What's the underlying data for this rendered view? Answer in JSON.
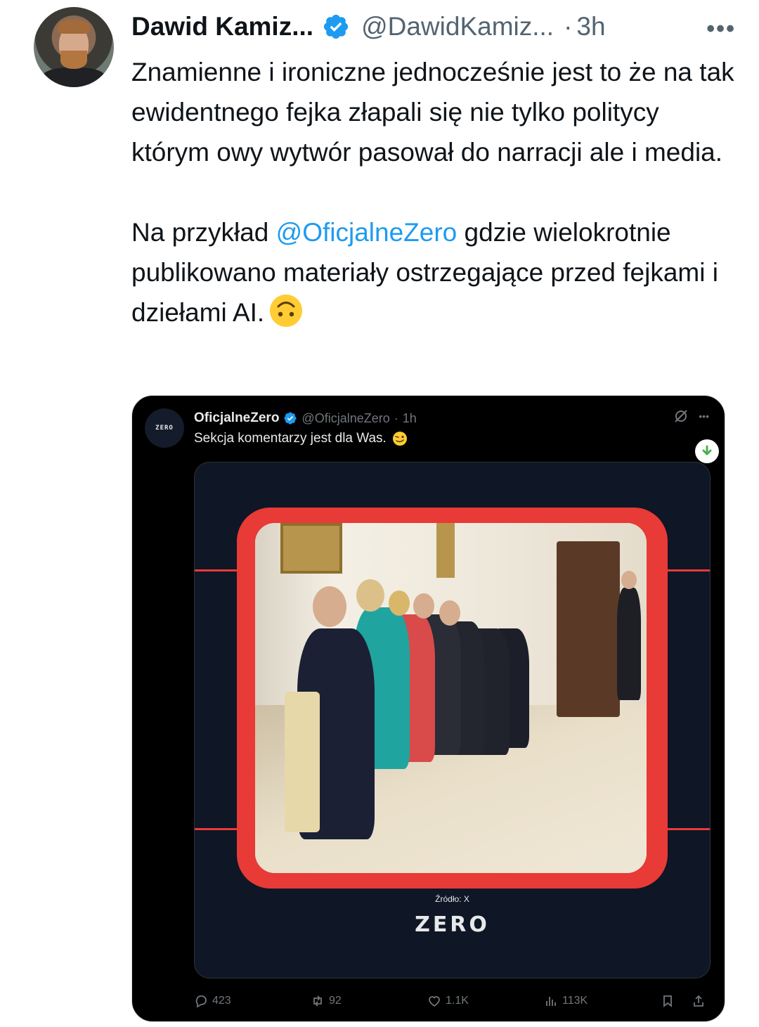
{
  "post": {
    "author_name": "Dawid Kamiz...",
    "author_handle": "@DawidKamiz...",
    "time": "3h",
    "separator": "·",
    "text_p1": "Znamienne i ironiczne jednocześnie jest to że na tak ewidentnego fejka złapali się nie tylko politycy którym owy wytwór pasował do narracji ale i media.",
    "text_p2_before": "Na przykład ",
    "text_p2_mention": "@OficjalneZero",
    "text_p2_after": " gdzie wielokrotnie publikowano materiały ostrzegające przed fejkami i dziełami AI."
  },
  "quoted": {
    "avatar_text": "ZERO",
    "author_name": "OficjalneZero",
    "author_handle": "@OficjalneZero",
    "time": "1h",
    "separator": "·",
    "text": "Sekcja komentarzy jest dla Was.",
    "media": {
      "source_caption": "Źródło: X",
      "logo_text": "ZERO"
    },
    "actions": {
      "replies": "423",
      "reposts": "92",
      "likes": "1.1K",
      "views": "113K"
    }
  },
  "colors": {
    "link": "#1d9bf0",
    "verified": "#1d9bf0",
    "frame_red": "#e83a36",
    "quote_bg": "#000000"
  }
}
